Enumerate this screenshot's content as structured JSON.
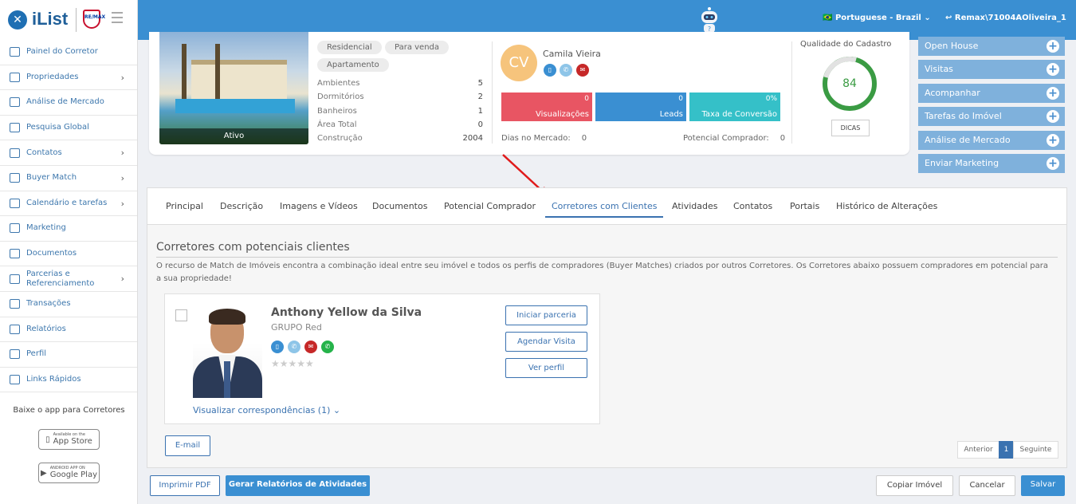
{
  "header": {
    "logo_text": "iList",
    "brand_badge": "RE/MAX",
    "language": "Portuguese - Brazil",
    "user": "Remax\\71004AOliveira_1"
  },
  "sidebar": {
    "items": [
      {
        "label": "Painel do Corretor",
        "icon": "dashboard-icon",
        "chevron": false
      },
      {
        "label": "Propriedades",
        "icon": "home-icon",
        "chevron": true
      },
      {
        "label": "Análise de Mercado",
        "icon": "bar-chart-icon",
        "chevron": false
      },
      {
        "label": "Pesquisa Global",
        "icon": "search-icon",
        "chevron": false
      },
      {
        "label": "Contatos",
        "icon": "contacts-icon",
        "chevron": true
      },
      {
        "label": "Buyer Match",
        "icon": "match-icon",
        "chevron": true
      },
      {
        "label": "Calendário e tarefas",
        "icon": "calendar-icon",
        "chevron": true
      },
      {
        "label": "Marketing",
        "icon": "newspaper-icon",
        "chevron": false
      },
      {
        "label": "Documentos",
        "icon": "folder-icon",
        "chevron": false
      },
      {
        "label": "Parcerias e Referenciamento",
        "icon": "handshake-icon",
        "chevron": true
      },
      {
        "label": "Transações",
        "icon": "briefcase-icon",
        "chevron": false
      },
      {
        "label": "Relatórios",
        "icon": "report-icon",
        "chevron": false
      },
      {
        "label": "Perfil",
        "icon": "user-icon",
        "chevron": false
      },
      {
        "label": "Links Rápidos",
        "icon": "link-icon",
        "chevron": false
      }
    ],
    "app_text": "Baixe o app para Corretores",
    "app_store": {
      "small": "Available on the",
      "big": "App Store"
    },
    "google_play": {
      "small": "ANDROID APP ON",
      "big": "Google Play"
    }
  },
  "property": {
    "status": "Ativo",
    "tags": [
      "Residencial",
      "Para venda",
      "Apartamento"
    ],
    "details": [
      {
        "label": "Ambientes",
        "value": "5"
      },
      {
        "label": "Dormitórios",
        "value": "2"
      },
      {
        "label": "Banheiros",
        "value": "1"
      },
      {
        "label": "Área Total",
        "value": "0"
      },
      {
        "label": "Construção",
        "value": "2004"
      }
    ],
    "agent": {
      "initials": "CV",
      "name": "Camila Vieira"
    },
    "stats": [
      {
        "value": "0",
        "label": "Visualizações",
        "color": "#e85563"
      },
      {
        "value": "0",
        "label": "Leads",
        "color": "#3a8fd2"
      },
      {
        "value": "0%",
        "label": "Taxa de Conversão",
        "color": "#35c0c8"
      }
    ],
    "dias_label": "Dias no Mercado:",
    "dias_value": "0",
    "potencial_label": "Potencial Comprador:",
    "potencial_value": "0",
    "quality_title": "Qualidade do Cadastro",
    "quality_score": "84",
    "dicas": "DICAS"
  },
  "actions": [
    "Open House",
    "Visitas",
    "Acompanhar",
    "Tarefas do Imóvel",
    "Análise de Mercado",
    "Enviar Marketing"
  ],
  "tabs": [
    "Principal",
    "Descrição",
    "Imagens e Vídeos",
    "Documentos",
    "Potencial Comprador",
    "Corretores com Clientes",
    "Atividades",
    "Contatos",
    "Portais",
    "Histórico de Alterações"
  ],
  "section": {
    "title": "Corretores com potenciais clientes",
    "description": "O recurso de Match de Imóveis encontra a combinação ideal entre seu imóvel e todos os perfis de compradores (Buyer Matches) criados por outros Corretores. Os Corretores abaixo possuem compradores em potencial para a sua propriedade!"
  },
  "broker": {
    "name": "Anthony Yellow da Silva",
    "group": "GRUPO Red",
    "rating": 0,
    "stars": "★★★★★",
    "matches": "Visualizar correspondências (1)",
    "buttons": [
      "Iniciar parceria",
      "Agendar Visita",
      "Ver perfil"
    ]
  },
  "email_button": "E-mail",
  "pagination": {
    "prev": "Anterior",
    "page": "1",
    "next": "Seguinte"
  },
  "footer": {
    "print": "Imprimir PDF",
    "reports": "Gerar Relatórios de Atividades",
    "copy": "Copiar Imóvel",
    "cancel": "Cancelar",
    "save": "Salvar"
  }
}
